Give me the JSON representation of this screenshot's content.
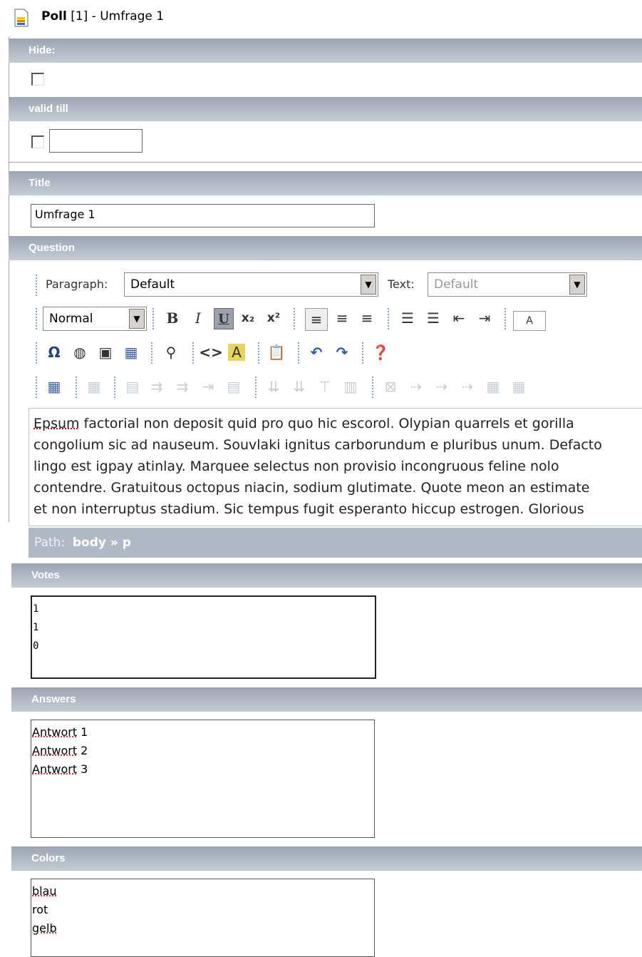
{
  "header": {
    "icon": "document-icon",
    "title_bold": "Poll",
    "title_rest": " [1] - Umfrage 1"
  },
  "fields": {
    "hide": {
      "label": "Hide:",
      "checked": false
    },
    "valid_till": {
      "label": "valid till",
      "checked": false,
      "value": ""
    },
    "title": {
      "label": "Title",
      "value": "Umfrage 1"
    },
    "question": {
      "label": "Question"
    },
    "votes": {
      "label": "Votes",
      "lines": [
        "1",
        "1",
        "0"
      ]
    },
    "answers": {
      "label": "Answers",
      "lines": [
        "Antwort 1",
        "Antwort 2",
        "Antwort 3"
      ]
    },
    "colors": {
      "label": "Colors",
      "lines": [
        "blau",
        "rot",
        "gelb"
      ]
    }
  },
  "editor": {
    "paragraph_label": "Paragraph:",
    "paragraph_value": "Default",
    "text_label": "Text:",
    "text_value": "Default",
    "style_value": "Normal",
    "bold": "B",
    "italic": "I",
    "underline": "U",
    "subscript": "x₂",
    "superscript": "x²",
    "textcolor": "A",
    "content_lines": [
      "Epsum factorial non deposit quid pro quo hic escorol. Olypian quarrels et gorilla",
      "congolium sic ad nauseum. Souvlaki ignitus carborundum e pluribus unum. Defacto",
      "lingo est igpay atinlay. Marquee selectus non provisio incongruous feline nolo",
      "contendre. Gratuitous octopus niacin, sodium glutimate. Quote meon an estimate",
      "et non interruptus stadium. Sic tempus fugit esperanto hiccup estrogen. Glorious"
    ],
    "first_word": "Epsum",
    "path_label": "Path:",
    "path_value": "body » p"
  },
  "colors_ui": {
    "bar": "#a5aebb",
    "accent_link": "#8aa2c8"
  }
}
